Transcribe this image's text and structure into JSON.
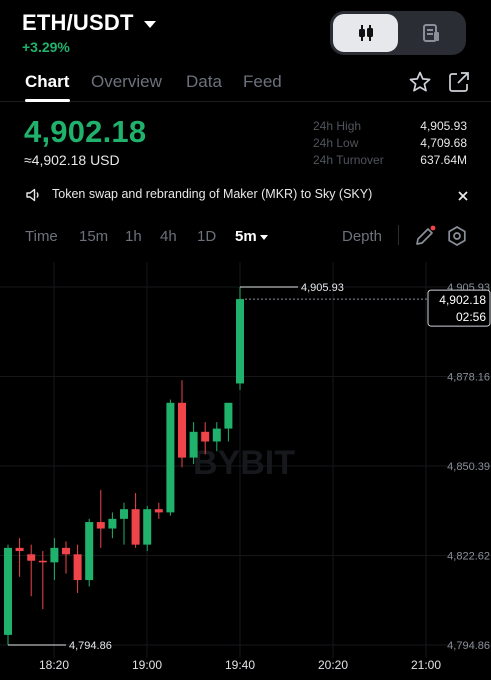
{
  "header": {
    "pair": "ETH/USDT",
    "change": "+3.29%",
    "mode_icons": [
      "candlestick-chart-icon",
      "document-icon"
    ]
  },
  "tabs": [
    "Chart",
    "Overview",
    "Data",
    "Feed"
  ],
  "summary": {
    "price": "4,902.18",
    "price_usd": "≈4,902.18 USD",
    "stats": [
      {
        "label": "24h High",
        "value": "4,905.93"
      },
      {
        "label": "24h Low",
        "value": "4,709.68"
      },
      {
        "label": "24h Turnover",
        "value": "637.64M"
      }
    ]
  },
  "notice": {
    "text": "Token swap and rebranding of Maker (MKR) to Sky (SKY)"
  },
  "timeframes": [
    "Time",
    "15m",
    "1h",
    "4h",
    "1D",
    "5m"
  ],
  "depth_label": "Depth",
  "colors": {
    "up": "#20b26c",
    "down": "#ef454a",
    "background": "#000000"
  },
  "chart_data": {
    "type": "candlestick",
    "watermark": "BYBIT",
    "ylim": [
      4790,
      4910
    ],
    "y_ticks": [
      "4,905.93",
      "4,878.16",
      "4,850.39",
      "4,822.62",
      "4,794.86"
    ],
    "y_tick_values": [
      4905.93,
      4878.16,
      4850.39,
      4822.62,
      4794.86
    ],
    "x_ticks": [
      "18:20",
      "19:00",
      "19:40",
      "20:20",
      "21:00"
    ],
    "high_label": "4,905.93",
    "low_label": "4,794.86",
    "last_price": "4,902.18",
    "countdown": "02:56",
    "candles": [
      {
        "o": 4798.0,
        "h": 4826.0,
        "l": 4794.86,
        "c": 4825.0
      },
      {
        "o": 4825.0,
        "h": 4828.0,
        "l": 4816.0,
        "c": 4824.0
      },
      {
        "o": 4823.0,
        "h": 4826.0,
        "l": 4810.0,
        "c": 4821.0
      },
      {
        "o": 4821.0,
        "h": 4824.0,
        "l": 4806.0,
        "c": 4820.5
      },
      {
        "o": 4820.5,
        "h": 4828.0,
        "l": 4815.0,
        "c": 4825.0
      },
      {
        "o": 4825.0,
        "h": 4827.0,
        "l": 4817.0,
        "c": 4823.0
      },
      {
        "o": 4823.0,
        "h": 4826.0,
        "l": 4811.0,
        "c": 4815.0
      },
      {
        "o": 4815.0,
        "h": 4834.0,
        "l": 4813.0,
        "c": 4833.0
      },
      {
        "o": 4833.0,
        "h": 4843.0,
        "l": 4825.0,
        "c": 4831.0
      },
      {
        "o": 4831.0,
        "h": 4836.0,
        "l": 4828.0,
        "c": 4834.0
      },
      {
        "o": 4834.0,
        "h": 4839.0,
        "l": 4826.0,
        "c": 4837.0
      },
      {
        "o": 4837.0,
        "h": 4842.0,
        "l": 4825.0,
        "c": 4826.0
      },
      {
        "o": 4826.0,
        "h": 4838.0,
        "l": 4824.0,
        "c": 4837.0
      },
      {
        "o": 4837.0,
        "h": 4839.0,
        "l": 4834.0,
        "c": 4836.0
      },
      {
        "o": 4836.0,
        "h": 4871.0,
        "l": 4835.0,
        "c": 4870.0
      },
      {
        "o": 4870.0,
        "h": 4877.0,
        "l": 4850.0,
        "c": 4853.0
      },
      {
        "o": 4853.0,
        "h": 4864.0,
        "l": 4851.0,
        "c": 4861.0
      },
      {
        "o": 4861.0,
        "h": 4864.0,
        "l": 4854.0,
        "c": 4858.0
      },
      {
        "o": 4858.0,
        "h": 4864.0,
        "l": 4855.0,
        "c": 4862.0
      },
      {
        "o": 4862.0,
        "h": 4870.0,
        "l": 4858.0,
        "c": 4870.0
      },
      {
        "o": 4876.0,
        "h": 4905.93,
        "l": 4874.0,
        "c": 4902.18
      }
    ]
  }
}
